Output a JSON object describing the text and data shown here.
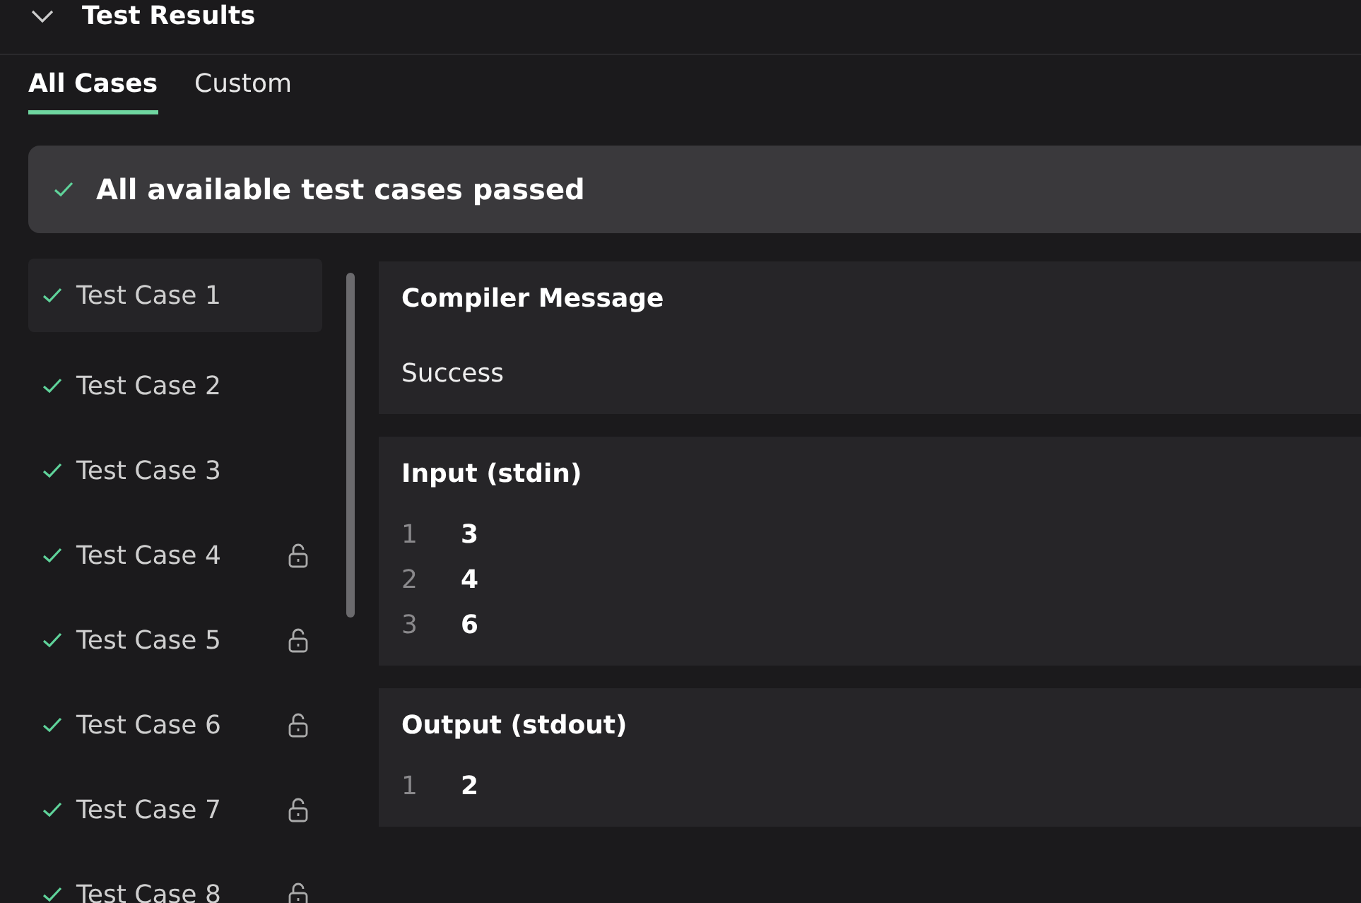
{
  "panel": {
    "title": "Test Results",
    "expanded": true
  },
  "tabs": [
    {
      "label": "All Cases",
      "selected": true
    },
    {
      "label": "Custom",
      "selected": false
    }
  ],
  "banner": {
    "passed": true,
    "message": "All available test cases passed"
  },
  "test_cases": [
    {
      "label": "Test Case 1",
      "passed": true,
      "locked": false,
      "selected": true
    },
    {
      "label": "Test Case 2",
      "passed": true,
      "locked": false,
      "selected": false
    },
    {
      "label": "Test Case 3",
      "passed": true,
      "locked": false,
      "selected": false
    },
    {
      "label": "Test Case 4",
      "passed": true,
      "locked": true,
      "selected": false
    },
    {
      "label": "Test Case 5",
      "passed": true,
      "locked": true,
      "selected": false
    },
    {
      "label": "Test Case 6",
      "passed": true,
      "locked": true,
      "selected": false
    },
    {
      "label": "Test Case 7",
      "passed": true,
      "locked": true,
      "selected": false
    },
    {
      "label": "Test Case 8",
      "passed": true,
      "locked": true,
      "selected": false
    }
  ],
  "details": [
    {
      "kind": "message",
      "title": "Compiler Message",
      "text": "Success"
    },
    {
      "kind": "lines",
      "title": "Input (stdin)",
      "lines": [
        {
          "number": "1",
          "text": "3"
        },
        {
          "number": "2",
          "text": "4"
        },
        {
          "number": "3",
          "text": "6"
        }
      ]
    },
    {
      "kind": "lines",
      "title": "Output (stdout)",
      "lines": [
        {
          "number": "1",
          "text": "2"
        }
      ]
    }
  ]
}
